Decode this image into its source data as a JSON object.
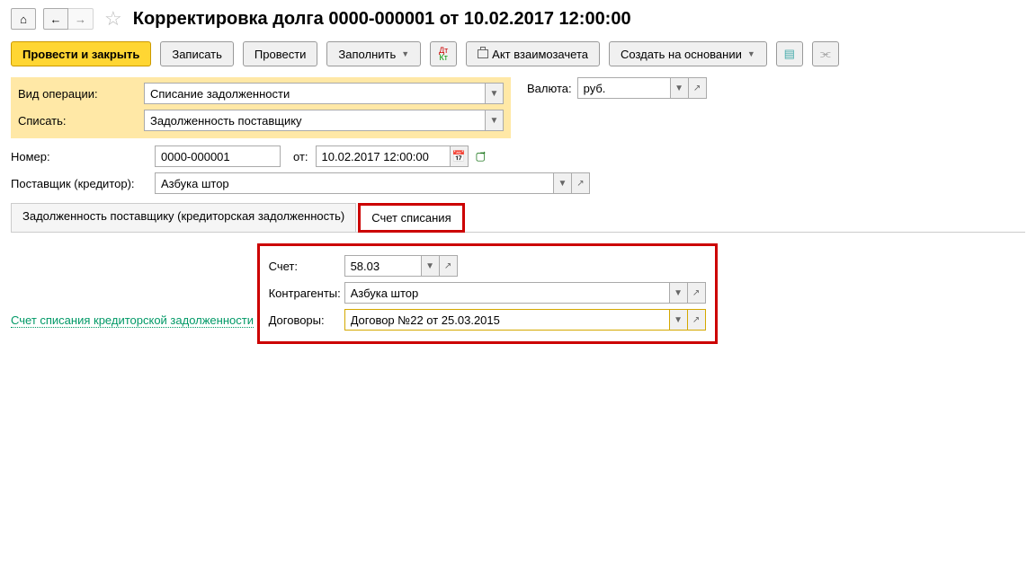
{
  "title": "Корректировка долга 0000-000001 от 10.02.2017 12:00:00",
  "toolbar": {
    "post_close": "Провести и закрыть",
    "write": "Записать",
    "post": "Провести",
    "fill": "Заполнить",
    "act": "Акт взаимозачета",
    "create_based": "Создать на основании"
  },
  "labels": {
    "operation_type": "Вид операции:",
    "write_off": "Списать:",
    "number": "Номер:",
    "from": "от:",
    "supplier": "Поставщик (кредитор):",
    "currency": "Валюта:",
    "account": "Счет:",
    "contractors": "Контрагенты:",
    "contracts": "Договоры:"
  },
  "values": {
    "operation_type": "Списание задолженности",
    "write_off": "Задолженность поставщику",
    "number": "0000-000001",
    "date": "10.02.2017 12:00:00",
    "supplier": "Азбука штор",
    "currency": "руб.",
    "account": "58.03",
    "contractors": "Азбука штор",
    "contracts": "Договор №22 от 25.03.2015"
  },
  "tabs": {
    "debt": "Задолженность поставщику (кредиторская задолженность)",
    "writeoff_account": "Счет списания"
  },
  "section": {
    "title": "Счет списания кредиторской задолженности"
  }
}
